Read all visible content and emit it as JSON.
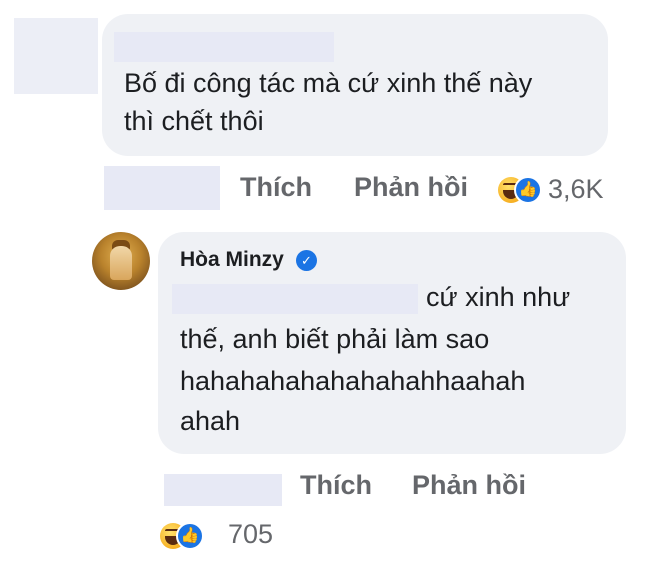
{
  "comment1": {
    "text_line1": "Bố đi công tác mà cứ xinh thế này",
    "text_line2": "thì chết thôi",
    "like_label": "Thích",
    "reply_label": "Phản hồi",
    "reaction_count": "3,6K",
    "reaction_icons": [
      "haha-icon",
      "like-icon"
    ]
  },
  "reply": {
    "author_name": "Hòa Minzy",
    "verified": true,
    "text_line1": "cứ xinh như",
    "text_line2": "thế, anh biết phải làm sao",
    "text_line3": "hahahahahahahahahhaahah",
    "text_line4": "ahah",
    "like_label": "Thích",
    "reply_label": "Phản hồi",
    "reaction_count": "705",
    "reaction_icons": [
      "haha-icon",
      "like-icon"
    ]
  },
  "colors": {
    "bubble_bg": "#eff1f5",
    "action_text": "#65676b",
    "verified_blue": "#1b74e4"
  }
}
